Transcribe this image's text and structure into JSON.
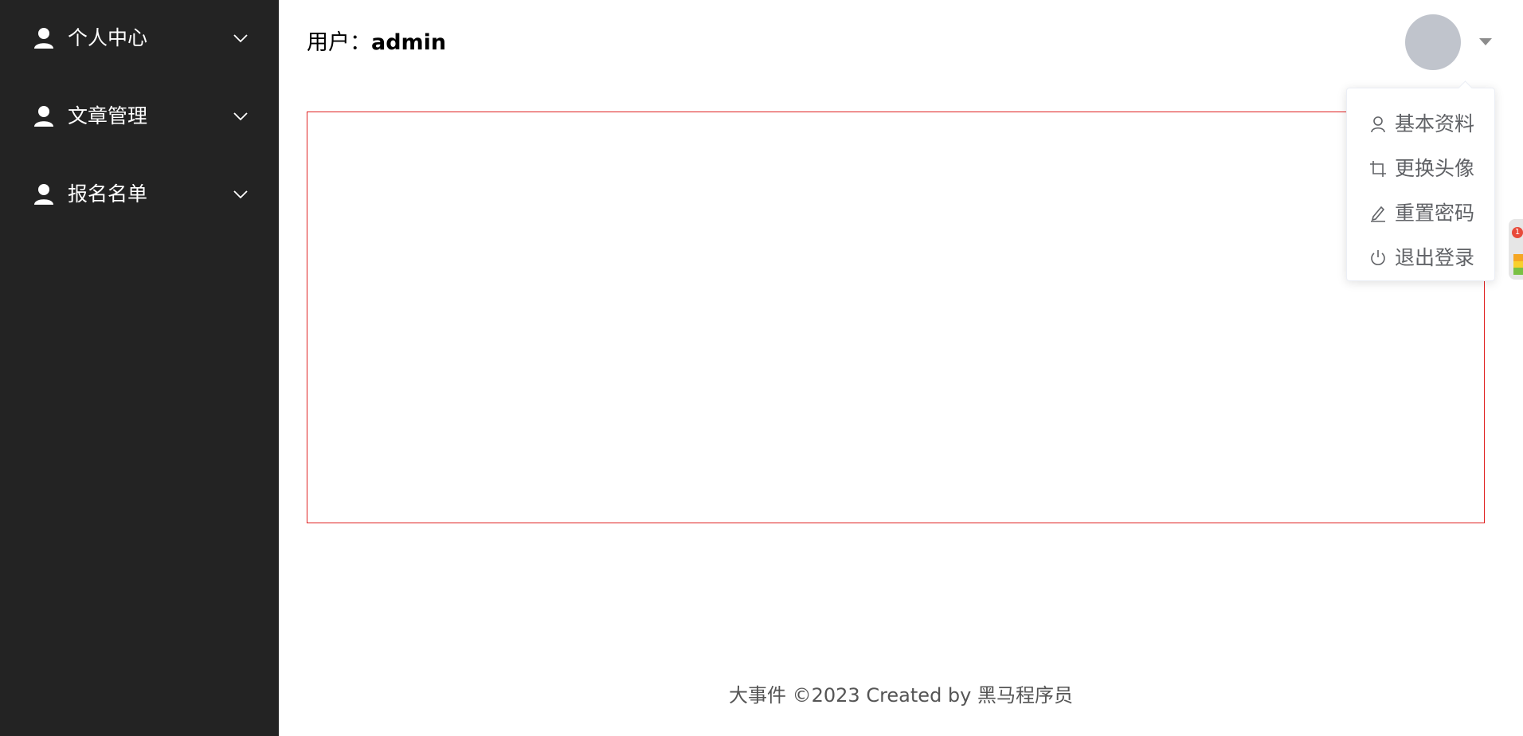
{
  "sidebar": {
    "items": [
      {
        "label": "个人中心",
        "icon": "user-icon"
      },
      {
        "label": "文章管理",
        "icon": "user-icon"
      },
      {
        "label": "报名名单",
        "icon": "user-icon"
      }
    ]
  },
  "header": {
    "user_prefix": "用户：",
    "username": "admin"
  },
  "dropdown": {
    "items": [
      {
        "label": "基本资料",
        "icon": "user-outline-icon"
      },
      {
        "label": "更换头像",
        "icon": "crop-icon"
      },
      {
        "label": "重置密码",
        "icon": "edit-pen-icon"
      },
      {
        "label": "退出登录",
        "icon": "power-icon"
      }
    ]
  },
  "footer": {
    "text": "大事件 ©2023 Created by 黑马程序员"
  },
  "side_widget": {
    "badge": "1"
  },
  "colors": {
    "sidebar_bg": "#232323",
    "content_border": "#e02020",
    "avatar_bg": "#c0c4cc",
    "dropdown_text": "#606266"
  }
}
